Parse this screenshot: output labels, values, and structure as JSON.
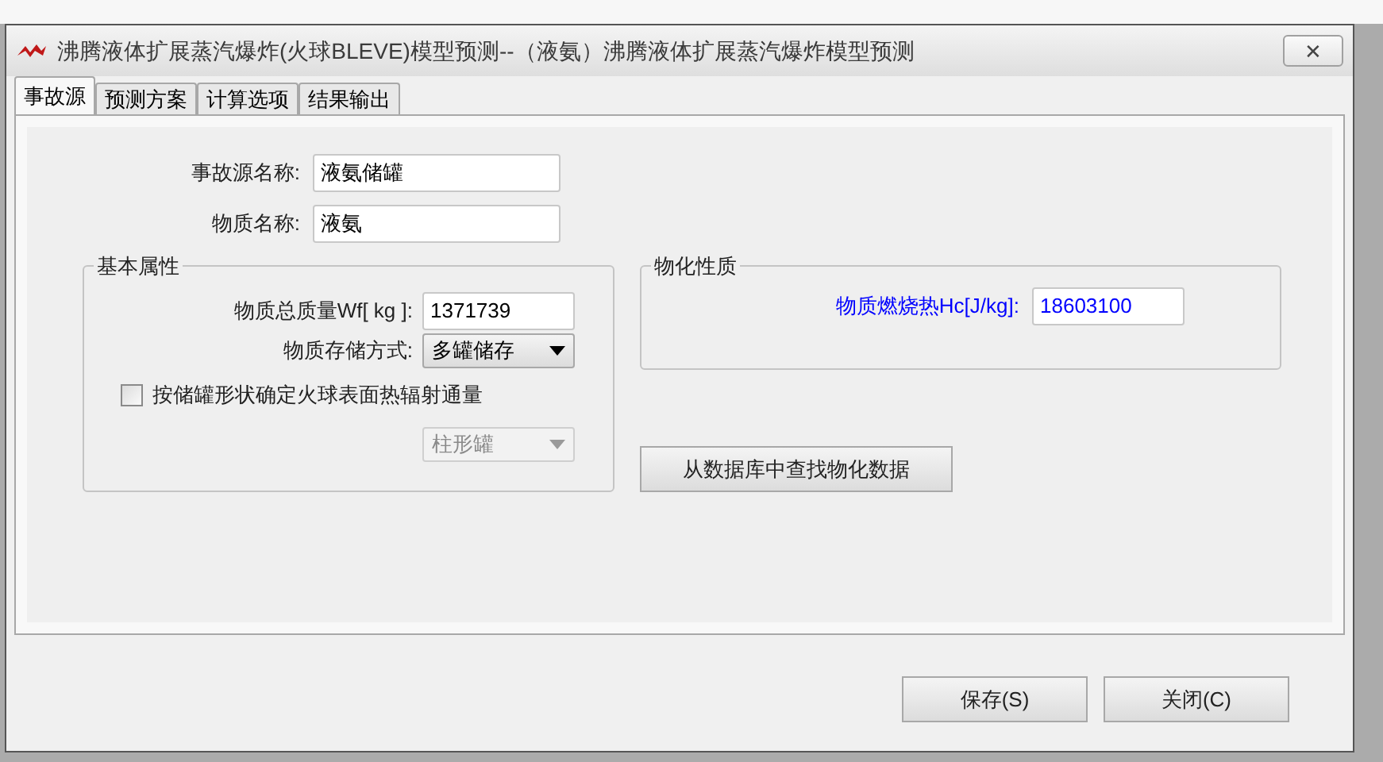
{
  "window": {
    "title": "沸腾液体扩展蒸汽爆炸(火球BLEVE)模型预测--（液氨）沸腾液体扩展蒸汽爆炸模型预测",
    "close": "✕"
  },
  "tabs": [
    {
      "label": "事故源",
      "selected": true
    },
    {
      "label": "预测方案",
      "selected": false
    },
    {
      "label": "计算选项",
      "selected": false
    },
    {
      "label": "结果输出",
      "selected": false
    }
  ],
  "source_fields": [
    {
      "label": "事故源名称:",
      "value": "液氨储罐"
    },
    {
      "label": "物质名称:",
      "value": "液氨"
    }
  ],
  "basic": {
    "title": "基本属性",
    "mass": {
      "label": "物质总质量Wf[ kg ]:",
      "value": "1371739"
    },
    "storage": {
      "label": "物质存储方式:",
      "value": "多罐储存",
      "disabled": false
    },
    "checkbox": {
      "label": "按储罐形状确定火球表面热辐射通量",
      "checked": false
    },
    "shape": {
      "value": "柱形罐",
      "disabled": true
    }
  },
  "physchem": {
    "title": "物化性质",
    "heat": {
      "label": "物质燃烧热Hc[J/kg]:",
      "value": "18603100"
    },
    "lookup_button": "从数据库中查找物化数据"
  },
  "buttons": [
    "保存(S)",
    "关闭(C)"
  ]
}
